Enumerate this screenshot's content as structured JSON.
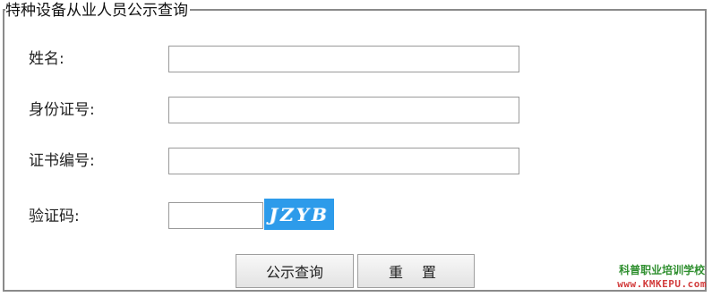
{
  "form": {
    "legend": "特种设备从业人员公示查询",
    "name_label": "姓名:",
    "id_label": "身份证号:",
    "cert_label": "证书编号:",
    "captcha_label": "验证码:",
    "name_value": "",
    "id_value": "",
    "cert_value": "",
    "captcha_value": "",
    "captcha_text": "JZYB",
    "query_button": "公示查询",
    "reset_button": "重 置"
  },
  "watermark": {
    "chinese": "科普职业培训学校",
    "url": "www.KMKEPU.com"
  },
  "colors": {
    "captcha_bg": "#2d9bea",
    "watermark_green": "#2f8f2f",
    "watermark_red": "#d23c3c"
  }
}
